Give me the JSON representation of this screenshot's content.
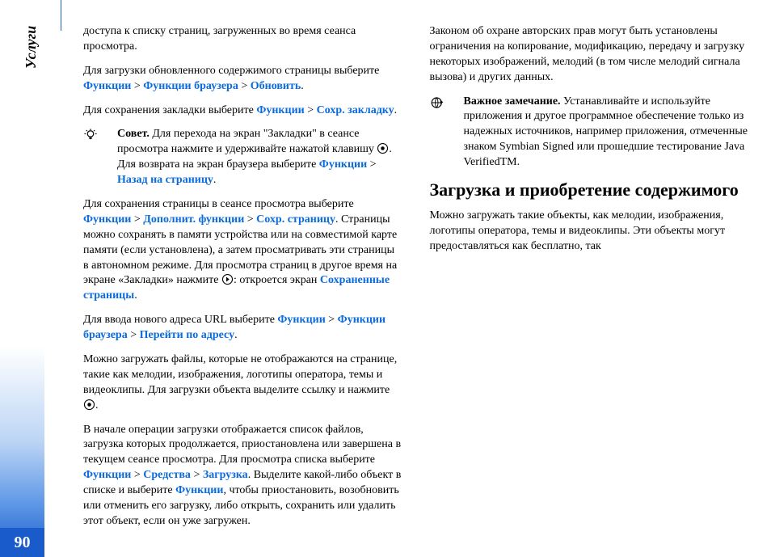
{
  "sidebar": {
    "section_label": "Услуги",
    "page_number": "90"
  },
  "col1": {
    "p1": "доступа к списку страниц, загруженных во время сеанса просмотра.",
    "p2_a": "Для загрузки обновленного содержимого страницы выберите ",
    "p2_l1": "Функции",
    "p2_l2": "Функции браузера",
    "p2_l3": "Обновить",
    "p3_a": "Для сохранения закладки выберите ",
    "p3_l1": "Функции",
    "p3_l2": "Сохр. закладку",
    "tip_label": "Совет.",
    "tip_a": " Для перехода на экран \"Закладки\" в сеансе просмотра нажмите и удерживайте нажатой клавишу ",
    "tip_b": ". Для возврата на экран браузера выберите ",
    "tip_l1": "Функции",
    "tip_l2": "Назад на страницу",
    "p4_a": "Для сохранения страницы в сеансе просмотра выберите ",
    "p4_l1": "Функции",
    "p4_l2": "Дополнит. функции",
    "p4_l3": "Сохр. страницу",
    "p4_b": ". Страницы можно сохранять в памяти устройства или на совместимой карте памяти (если установлена), а затем просматривать эти страницы в автономном режиме. Для просмотра страниц в другое время на экране «Закладки» нажмите ",
    "p4_c": ": откроется экран ",
    "p4_l4": "Сохраненные страницы",
    "p5_a": "Для ввода нового адреса URL выберите ",
    "p5_l1": "Функции",
    "p5_l2": "Функции браузера",
    "p5_l3": "Перейти по адресу",
    "p6_a": "Можно загружать файлы, которые не отображаются на странице, такие как мелодии, изображения, логотипы оператора, темы и видеоклипы. Для загрузки объекта выделите ссылку и нажмите "
  },
  "col2": {
    "p1_a": "В начале операции загрузки отображается список файлов, загрузка которых продолжается, приостановлена или завершена в текущем сеансе просмотра. Для просмотра списка выберите ",
    "p1_l1": "Функции",
    "p1_l2": "Средства",
    "p1_l3": "Загрузка",
    "p1_b": ". Выделите какой-либо объект в списке и выберите ",
    "p1_l4": "Функции",
    "p1_c": ", чтобы приостановить, возобновить или отменить его загрузку, либо открыть, сохранить или удалить этот объект, если он уже загружен.",
    "p2": "Законом об охране авторских прав могут быть установлены ограничения на копирование, модификацию, передачу и загрузку некоторых изображений, мелодий (в том числе мелодий сигнала вызова) и других данных.",
    "note_label": "Важное замечание.",
    "note_body": " Устанавливайте и используйте приложения и другое программное обеспечение только из надежных источников, например приложения, отмеченные знаком Symbian Signed или прошедшие тестирование Java VerifiedTM.",
    "h2": "Загрузка и приобретение содержимого",
    "p3": "Можно загружать такие объекты, как мелодии, изображения, логотипы оператора, темы и видеоклипы. Эти объекты могут предоставляться как бесплатно, так"
  }
}
